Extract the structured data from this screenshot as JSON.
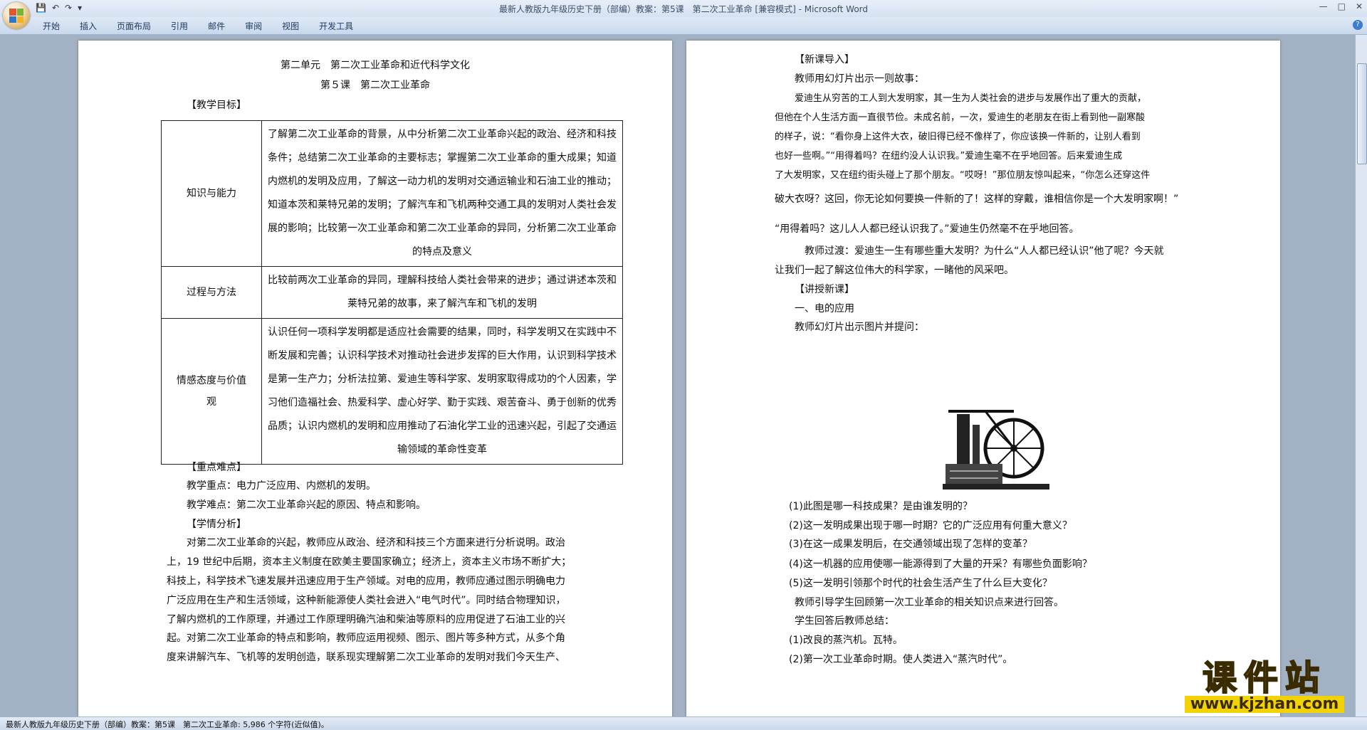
{
  "window": {
    "title": "最新人教版九年级历史下册（部编）教案：第5课　第二次工业革命 [兼容模式] - Microsoft Word",
    "minimize": "—",
    "maximize": "□",
    "close": "✕"
  },
  "ribbon": {
    "tabs": [
      "开始",
      "插入",
      "页面布局",
      "引用",
      "邮件",
      "审阅",
      "视图",
      "开发工具"
    ],
    "help": "?"
  },
  "qat": {
    "save": "💾",
    "undo": "↶",
    "redo": "↷",
    "more": "▾"
  },
  "left_page": {
    "unit_title": "第二单元　第二次工业革命和近代科学文化",
    "lesson_title": "第５课　第二次工业革命",
    "goal_heading": "【教学目标】",
    "objectives": [
      {
        "label": "知识与能力",
        "content": "了解第二次工业革命的背景，从中分析第二次工业革命兴起的政治、经济和科技条件；总结第二次工业革命的主要标志；掌握第二次工业革命的重大成果；知道内燃机的发明及应用，了解这一动力机的发明对交通运输业和石油工业的推动；知道本茨和莱特兄弟的发明；了解汽车和飞机两种交通工具的发明对人类社会发展的影响；比较第一次工业革命和第二次工业革命的异同，分析第二次工业革命的特点及意义"
      },
      {
        "label": "过程与方法",
        "content": "比较前两次工业革命的异同，理解科技给人类社会带来的进步；通过讲述本茨和莱特兄弟的故事，来了解汽车和飞机的发明"
      },
      {
        "label": "情感态度与价值观",
        "content": "认识任何一项科学发明都是适应社会需要的结果，同时，科学发明又在实践中不断发展和完善；认识科学技术对推动社会进步发挥的巨大作用，认识到科学技术是第一生产力；分析法拉第、爱迪生等科学家、发明家取得成功的个人因素，学习他们造福社会、热爱科学、虚心好学、勤于实践、艰苦奋斗、勇于创新的优秀品质；认识内燃机的发明和应用推动了石油化学工业的迅速兴起，引起了交通运输领域的革命性变革"
      }
    ],
    "key_heading": "【重点难点】",
    "key_point": "教学重点：电力广泛应用、内燃机的发明。",
    "difficulty": "教学难点：第二次工业革命兴起的原因、特点和影响。",
    "analysis_heading": "【学情分析】",
    "analysis_lines": [
      "对第二次工业革命的兴起，教师应从政治、经济和科技三个方面来进行分析说明。政治",
      "上，19 世纪中后期，资本主义制度在欧美主要国家确立；经济上，资本主义市场不断扩大；",
      "科技上，科学技术飞速发展并迅速应用于生产领域。对电的应用，教师应通过图示明确电力",
      "广泛应用在生产和生活领域，这种新能源使人类社会进入“电气时代”。同时结合物理知识，",
      "了解内燃机的工作原理，并通过工作原理明确汽油和柴油等原料的应用促进了石油工业的兴",
      "起。对第二次工业革命的特点和影响，教师应运用视频、图示、图片等多种方式，从多个角",
      "度来讲解汽车、飞机等的发明创造，联系现实理解第二次工业革命的发明对我们今天生产、"
    ]
  },
  "right_page": {
    "intro_heading": "【新课导入】",
    "intro_line": "教师用幻灯片出示一则故事：",
    "story_lines": [
      "爱迪生从穷苦的工人到大发明家，其一生为人类社会的进步与发展作出了重大的贡献，",
      "但他在个人生活方面一直很节俭。未成名前，一次，爱迪生的老朋友在街上看到他一副寒酸",
      "的样子，说：“看你身上这件大衣，破旧得已经不像样了，你应该换一件新的，让别人看到",
      "也好一些啊。”“用得着吗？在纽约没人认识我。”爱迪生毫不在乎地回答。后来爱迪生成",
      "了大发明家，又在纽约街头碰上了那个朋友。“哎呀！”那位朋友惊叫起来，“你怎么还穿这件",
      "破大衣呀？这回，你无论如何要换一件新的了！这样的穿戴，谁相信你是一个大发明家啊！”",
      "“用得着吗？这儿人人都已经认识我了。”爱迪生仍然毫不在乎地回答。"
    ],
    "transition_lines": [
      "教师过渡：爱迪生一生有哪些重大发明？为什么“人人都已经认识”他了呢？今天就",
      "让我们一起了解这位伟大的科学家，一睹他的风采吧。"
    ],
    "lecture_heading": "【讲授新课】",
    "section1": "一、电的应用",
    "show_pic": "教师幻灯片出示图片并提问：",
    "questions": [
      "(1)此图是哪一科技成果？是由谁发明的？",
      "(2)这一发明成果出现于哪一时期？它的广泛应用有何重大意义？",
      "(3)在这一成果发明后，在交通领域出现了怎样的变革？",
      "(4)这一机器的应用使哪一能源得到了大量的开采？有哪些负面影响？",
      "(5)这一发明引领那个时代的社会生活产生了什么巨大变化？"
    ],
    "guide_line": "教师引导学生回顾第一次工业革命的相关知识点来进行回答。",
    "summary_line": "学生回答后教师总结：",
    "answers": [
      "(1)改良的蒸汽机。瓦特。",
      "(2)第一次工业革命时期。使人类进入“蒸汽时代”。"
    ]
  },
  "status": {
    "text": "最新人教版九年级历史下册（部编）教案：第5课　第二次工业革命: 5,986 个字符(近似值)。"
  },
  "watermark": {
    "cn": "课件站",
    "url": "www.kjzhan.com"
  }
}
